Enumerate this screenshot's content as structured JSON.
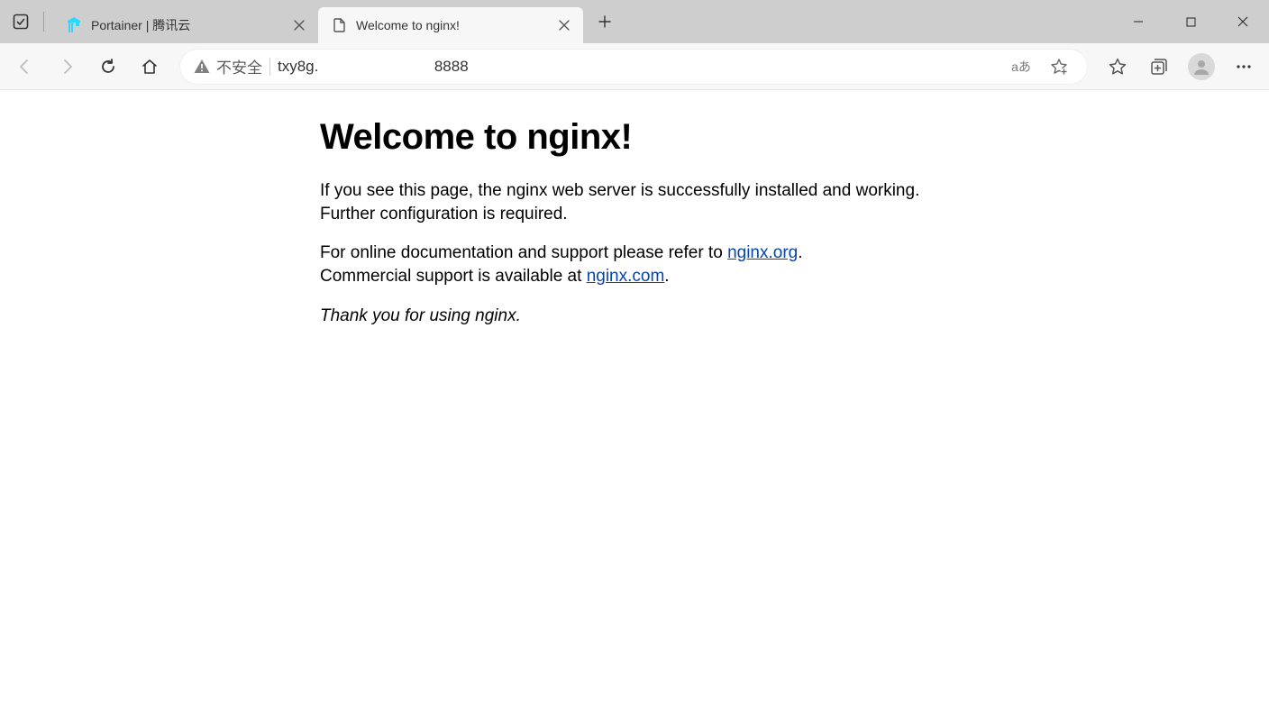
{
  "tabs": [
    {
      "title": "Portainer | 腾讯云"
    },
    {
      "title": "Welcome to nginx!"
    }
  ],
  "addressbar": {
    "security_label": "不安全",
    "url_visible_left": "txy8g.",
    "url_visible_right": "8888"
  },
  "toolbar_right": {
    "translate_label": "aあ"
  },
  "page": {
    "heading": "Welcome to nginx!",
    "paragraph1": "If you see this page, the nginx web server is successfully installed and working. Further configuration is required.",
    "paragraph2_prefix": "For online documentation and support please refer to ",
    "link1_text": "nginx.org",
    "paragraph2_mid": ".",
    "paragraph2_linebreak_prefix": "Commercial support is available at ",
    "link2_text": "nginx.com",
    "paragraph2_suffix": ".",
    "thanks": "Thank you for using nginx."
  }
}
